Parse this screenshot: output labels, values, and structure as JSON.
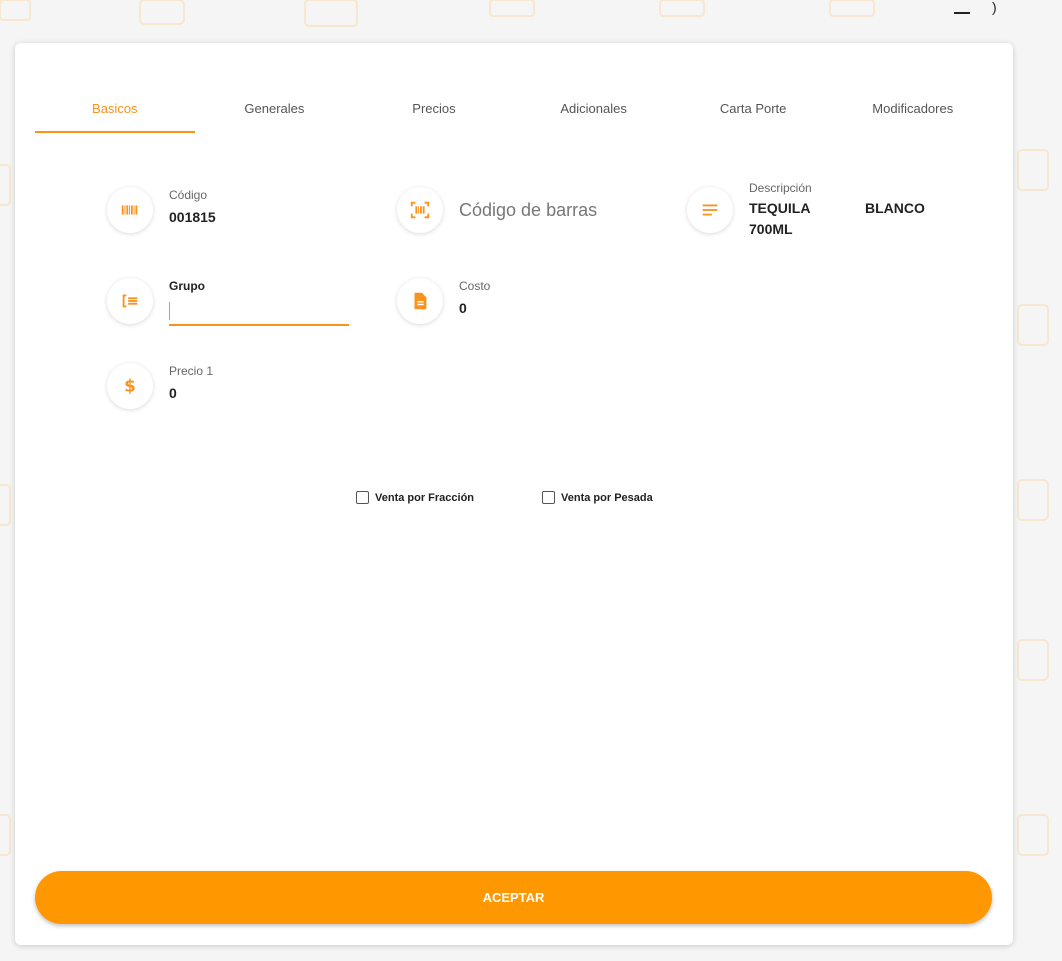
{
  "tabs": [
    {
      "label": "Basicos",
      "active": true
    },
    {
      "label": "Generales",
      "active": false
    },
    {
      "label": "Precios",
      "active": false
    },
    {
      "label": "Adicionales",
      "active": false
    },
    {
      "label": "Carta Porte",
      "active": false
    },
    {
      "label": "Modificadores",
      "active": false
    }
  ],
  "fields": {
    "codigo": {
      "label": "Código",
      "value": "001815",
      "icon": "barcode-icon"
    },
    "codigo_barras": {
      "placeholder": "Código de barras",
      "icon": "barcode-scan-icon"
    },
    "descripcion": {
      "label": "Descripción",
      "value_a": "TEQUILA 700ML",
      "value_b": "BLANCO",
      "icon": "description-lines-icon"
    },
    "grupo": {
      "label": "Grupo",
      "value": "",
      "icon": "list-group-icon"
    },
    "costo": {
      "label": "Costo",
      "value": "0",
      "icon": "document-icon"
    },
    "precio1": {
      "label": "Precio 1",
      "value": "0",
      "icon": "dollar-icon"
    }
  },
  "checkboxes": {
    "fraccion": {
      "label": "Venta por Fracción",
      "checked": false
    },
    "pesada": {
      "label": "Venta por Pesada",
      "checked": false
    }
  },
  "buttons": {
    "accept": "ACEPTAR"
  },
  "colors": {
    "accent": "#ff9800",
    "accent_text": "#f7931e"
  }
}
